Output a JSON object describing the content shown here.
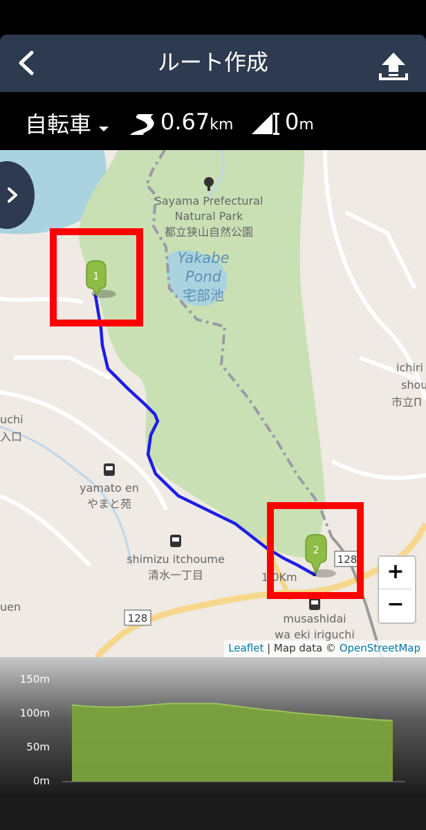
{
  "header": {
    "title": "ルート作成"
  },
  "info": {
    "mode": "自転車",
    "distance_value": "0.67",
    "distance_unit": "km",
    "elevation_value": "0",
    "elevation_unit": "m"
  },
  "map": {
    "labels": {
      "park_en1": "Sayama Prefectural",
      "park_en2": "Natural Park",
      "park_ja": "都立狭山自然公園",
      "pond_en1": "Yakabe",
      "pond_en2": "Pond",
      "pond_ja": "宅部池",
      "yamato_en": "yamato en",
      "yamato_ja": "やまと苑",
      "shimizu_en": "shimizu itchoume",
      "shimizu_ja": "清水一丁目",
      "musashi_en": "musashidai",
      "musashi_ja": "wa eki iriguchi",
      "route_128a": "128",
      "route_128b": "128",
      "marker_1": "1",
      "marker_2": "2",
      "dist_label": "1.0Km",
      "left_uchi": "uchi",
      "left_iriguchi": "入口",
      "left_uen": "uen",
      "right_ichiri": "ichiri",
      "right_shou": "shou",
      "right_shiritsu": "市立П"
    },
    "zoom_in": "+",
    "zoom_out": "−",
    "attribution_leaflet": "Leaflet",
    "attribution_sep": " | Map data © ",
    "attribution_osm": "OpenStreetMap"
  },
  "elevation_chart": {
    "y_labels": [
      "150m",
      "100m",
      "50m",
      "0m"
    ]
  },
  "colors": {
    "header_bg": "#2d3a4f",
    "route_line": "#1e1ee6",
    "highlight_box": "#ff0000",
    "park_green": "#c9e0b4",
    "chart_fill": "#7aa23c",
    "marker_green": "#8dbd44"
  },
  "chart_data": {
    "type": "area",
    "ylabel": "",
    "ylim": [
      0,
      150
    ],
    "y_ticks": [
      150,
      100,
      50,
      0
    ],
    "x": [
      0,
      0.05,
      0.1,
      0.15,
      0.2,
      0.25,
      0.3,
      0.35,
      0.4,
      0.45,
      0.5,
      0.55,
      0.6,
      0.65,
      0.7,
      0.75,
      0.8,
      0.85,
      0.9,
      0.95,
      1.0
    ],
    "values": [
      113,
      111,
      110,
      110,
      111,
      113,
      115,
      115,
      115,
      115,
      112,
      109,
      106,
      104,
      101,
      99,
      97,
      95,
      93,
      91,
      90
    ]
  }
}
